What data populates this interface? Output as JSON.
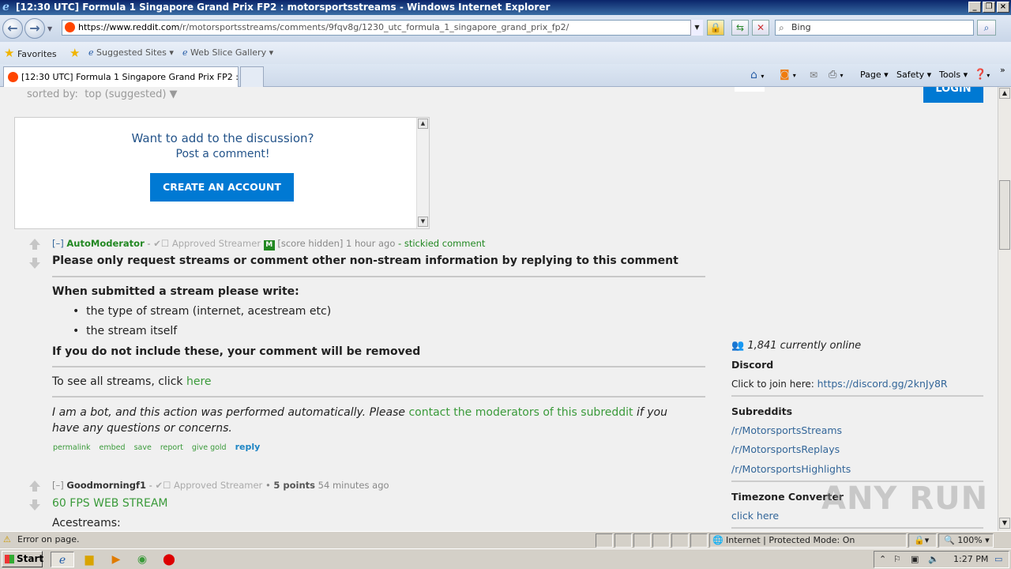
{
  "window": {
    "title": "[12:30 UTC] Formula 1 Singapore Grand Prix FP2 : motorsportsstreams - Windows Internet Explorer"
  },
  "toolbar": {
    "url_host": "https://www.reddit.com",
    "url_path": "/r/motorsportsstreams/comments/9fqv8g/1230_utc_formula_1_singapore_grand_prix_fp2/",
    "search_placeholder": "Bing"
  },
  "favorites": {
    "favorites_label": "Favorites",
    "suggested_sites": "Suggested Sites",
    "web_slice_gallery": "Web Slice Gallery"
  },
  "tabs": {
    "active_tab": "[12:30 UTC] Formula 1 Singapore Grand Prix FP2 : mo..."
  },
  "commandbar": {
    "page": "Page",
    "safety": "Safety",
    "tools": "Tools"
  },
  "page": {
    "sorted_by_label": "sorted by:",
    "sorted_by_value": "top (suggested)",
    "login_label": "LOGIN",
    "discussion_prompt": "Want to add to the discussion?",
    "post_comment": "Post a comment!",
    "create_account": "CREATE AN ACCOUNT"
  },
  "comments": [
    {
      "collapse": "[–]",
      "author": "AutoModerator",
      "flair": "✔☐ Approved Streamer",
      "badge": "M",
      "score": "[score hidden]",
      "time": "1 hour ago",
      "stickied": "stickied comment",
      "line1": "Please only request streams or comment other non-stream information by replying to this comment",
      "line2": "When submitted a stream please write:",
      "bullet1": "the type of stream (internet, acestream etc)",
      "bullet2": "the stream itself",
      "line3": "If you do not include these, your comment will be removed",
      "see_all_prefix": "To see all streams, click",
      "see_all_link": "here",
      "bot_prefix": "I am a bot, and this action was performed automatically. Please",
      "bot_link": "contact the moderators of this subreddit",
      "bot_suffix": "if you",
      "bot_line2": "have any questions or concerns.",
      "actions": [
        "permalink",
        "embed",
        "save",
        "report",
        "give gold"
      ],
      "reply": "reply"
    },
    {
      "collapse": "[–]",
      "author": "Goodmorningf1",
      "flair": "✔☐ Approved Streamer",
      "score": "5 points",
      "time": "54 minutes ago",
      "line1": "60 FPS WEB STREAM",
      "line2": "Acestreams:"
    }
  ],
  "sidebar": {
    "online": "1,841 currently online",
    "discord_heading": "Discord",
    "discord_text": "Click to join here:",
    "discord_link": "https://discord.gg/2knJy8R",
    "subreddits_heading": "Subreddits",
    "subreddits": [
      "/r/MotorsportsStreams",
      "/r/MotorsportsReplays",
      "/r/MotorsportsHighlights"
    ],
    "timezone_heading": "Timezone Converter",
    "timezone_link": "click here"
  },
  "watermark": "ANY RUN",
  "statusbar": {
    "error": "Error on page.",
    "zone": "Internet | Protected Mode: On",
    "zoom": "100%"
  },
  "taskbar": {
    "start": "Start",
    "clock": "1:27 PM"
  }
}
